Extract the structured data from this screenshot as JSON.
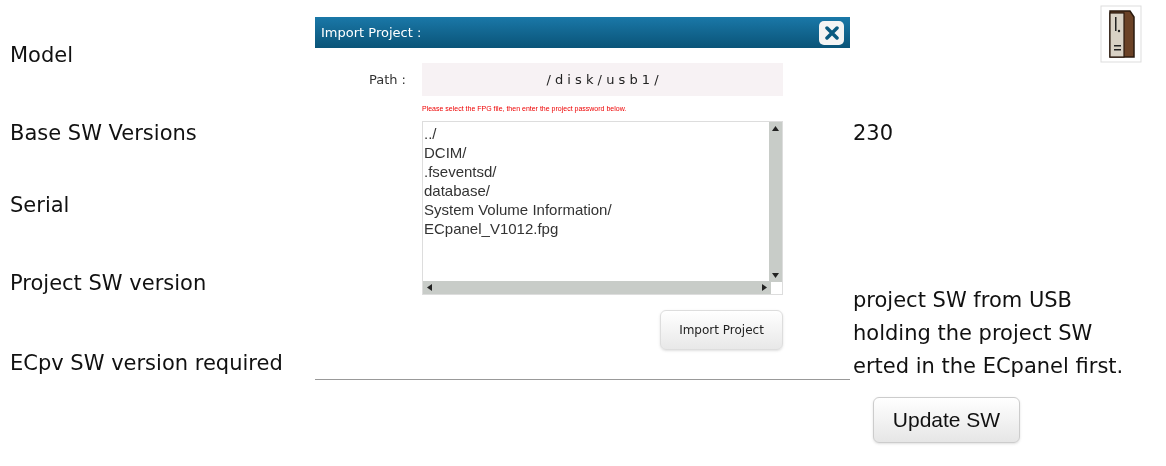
{
  "fields": [
    {
      "label": "Model"
    },
    {
      "label": "Base SW Versions",
      "value": "230"
    },
    {
      "label": "Serial"
    },
    {
      "label": "Project SW version"
    },
    {
      "label": "ECpv SW version required"
    }
  ],
  "update_note": [
    "project SW from USB",
    "holding the project SW",
    "erted in the ECpanel first."
  ],
  "update_button": "Update SW",
  "dialog": {
    "title": "Import Project :",
    "path_label": "Path :",
    "path": "/ d i s k / u s b 1 /",
    "hint": "Please select the FPG file, then enter the project password below.",
    "files": [
      "../",
      "DCIM/",
      ".fseventsd/",
      "database/",
      "System Volume Information/",
      "ECpanel_V1012.fpg"
    ],
    "import_button": "Import Project"
  }
}
